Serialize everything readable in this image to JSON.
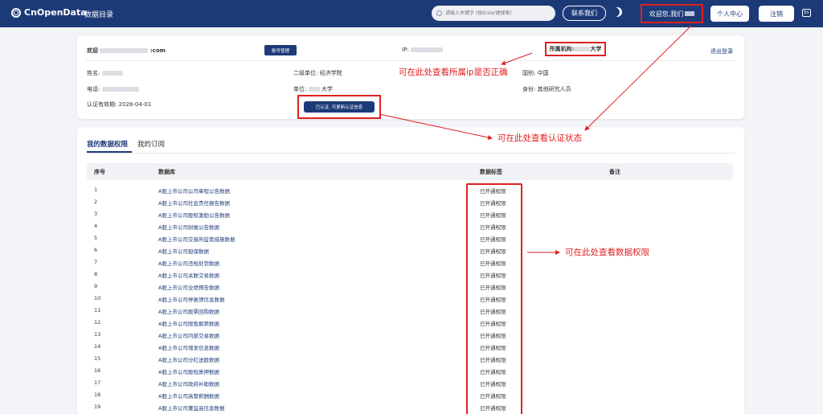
{
  "nav": {
    "logo": "CnOpenData",
    "catalog": "数据目录",
    "search_placeholder": "请输入关键字 (按Enter键搜索)",
    "contact": "联系我们",
    "welcome": "欢迎您,我们",
    "personal_center": "个人中心",
    "logout": "注销",
    "lang": "En"
  },
  "profile": {
    "welcome_prefix": "欢迎",
    "email_suffix": ":com",
    "account_mgmt": "账号管理",
    "ip_label": "IP:",
    "org_label": "所属机构:",
    "org_suffix": "大学",
    "logout_link": "退出登录",
    "name_label": "姓名:",
    "phone_label": "电话:",
    "valid_label": "认证有效期: 2026-04-01",
    "dept_label": "二级单位: 经济学院",
    "unit_label": "单位:",
    "unit_suffix": "大学",
    "status_button": "已认证, 可更新认证信息",
    "country_label": "国别: 中国",
    "identity_label": "身份: 其他研究人员"
  },
  "tabs": [
    "我的数据权限",
    "我的订阅"
  ],
  "table": {
    "headers": [
      "序号",
      "数据库",
      "数据标签",
      "备注"
    ],
    "rows": [
      {
        "no": "1",
        "db": "A股上市公司公司章程公告数据",
        "tag": "已开通权限"
      },
      {
        "no": "2",
        "db": "A股上市公司社会责任报告数据",
        "tag": "已开通权限"
      },
      {
        "no": "3",
        "db": "A股上市公司股权激励公告数据",
        "tag": "已开通权限"
      },
      {
        "no": "4",
        "db": "A股上市公司财报公告数据",
        "tag": "已开通权限"
      },
      {
        "no": "5",
        "db": "A股上市公司交易所监管措施数据",
        "tag": "已开通权限"
      },
      {
        "no": "6",
        "db": "A股上市公司担保数据",
        "tag": "已开通权限"
      },
      {
        "no": "7",
        "db": "A股上市公司违规处罚数据",
        "tag": "已开通权限"
      },
      {
        "no": "8",
        "db": "A股上市公司关联交易数据",
        "tag": "已开通权限"
      },
      {
        "no": "9",
        "db": "A股上市公司业绩预告数据",
        "tag": "已开通权限"
      },
      {
        "no": "10",
        "db": "A股上市公司停复牌信息数据",
        "tag": "已开通权限"
      },
      {
        "no": "11",
        "db": "A股上市公司股票回购数据",
        "tag": "已开通权限"
      },
      {
        "no": "12",
        "db": "A股上市公司限售解禁数据",
        "tag": "已开通权限"
      },
      {
        "no": "13",
        "db": "A股上市公司内部交易数据",
        "tag": "已开通权限"
      },
      {
        "no": "14",
        "db": "A股上市公司增发信息数据",
        "tag": "已开通权限"
      },
      {
        "no": "15",
        "db": "A股上市公司分红送股数据",
        "tag": "已开通权限"
      },
      {
        "no": "16",
        "db": "A股上市公司股权质押数据",
        "tag": "已开通权限"
      },
      {
        "no": "17",
        "db": "A股上市公司政府补助数据",
        "tag": "已开通权限"
      },
      {
        "no": "18",
        "db": "A股上市公司高管薪酬数据",
        "tag": "已开通权限"
      },
      {
        "no": "19",
        "db": "A股上市公司董监高信息数据",
        "tag": "已开通权限"
      }
    ]
  },
  "annotations": {
    "ip": "可在此处查看所属ip是否正确",
    "status": "可在此处查看认证状态",
    "perm": "可在此处查看数据权限"
  },
  "colors": {
    "primary": "#1d3a78",
    "annotation": "#e02020"
  }
}
